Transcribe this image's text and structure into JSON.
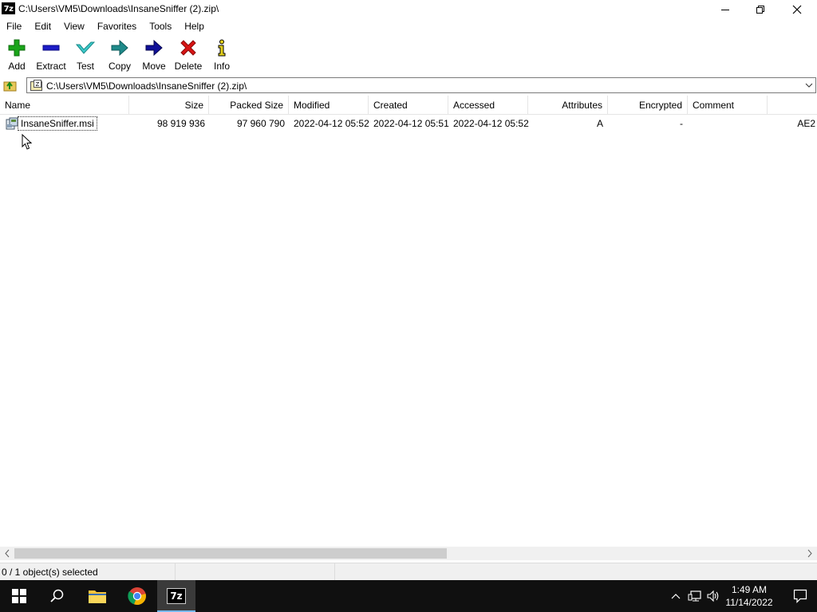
{
  "window": {
    "app_icon_text": "7z",
    "title": "C:\\Users\\VM5\\Downloads\\InsaneSniffer (2).zip\\"
  },
  "menu": [
    "File",
    "Edit",
    "View",
    "Favorites",
    "Tools",
    "Help"
  ],
  "toolbar": {
    "add": "Add",
    "extract": "Extract",
    "test": "Test",
    "copy": "Copy",
    "move": "Move",
    "delete": "Delete",
    "info": "Info"
  },
  "address": {
    "path": "C:\\Users\\VM5\\Downloads\\InsaneSniffer (2).zip\\"
  },
  "columns": {
    "name": "Name",
    "size": "Size",
    "packed_size": "Packed Size",
    "modified": "Modified",
    "created": "Created",
    "accessed": "Accessed",
    "attributes": "Attributes",
    "encrypted": "Encrypted",
    "comment": "Comment"
  },
  "files": [
    {
      "name": "InsaneSniffer.msi",
      "size": "98 919 936",
      "packed_size": "97 960 790",
      "modified": "2022-04-12 05:52",
      "created": "2022-04-12 05:51",
      "accessed": "2022-04-12 05:52",
      "attributes": "A",
      "encrypted": "-",
      "comment": "",
      "extra": "AE2"
    }
  ],
  "status": {
    "selection": "0 / 1 object(s) selected"
  },
  "clock": {
    "time": "1:49 AM",
    "date": "11/14/2022"
  },
  "taskbar": {
    "active_app_label": "7z"
  },
  "colors": {
    "add_green": "#1aa51a",
    "extract_blue": "#1c1cc7",
    "test_teal": "#3cc9c9",
    "copy_teal": "#1f8a8a",
    "move_navy": "#101099",
    "delete_red": "#d81414",
    "taskbar_bg": "#101010",
    "selection_accent": "#76b9ed"
  }
}
